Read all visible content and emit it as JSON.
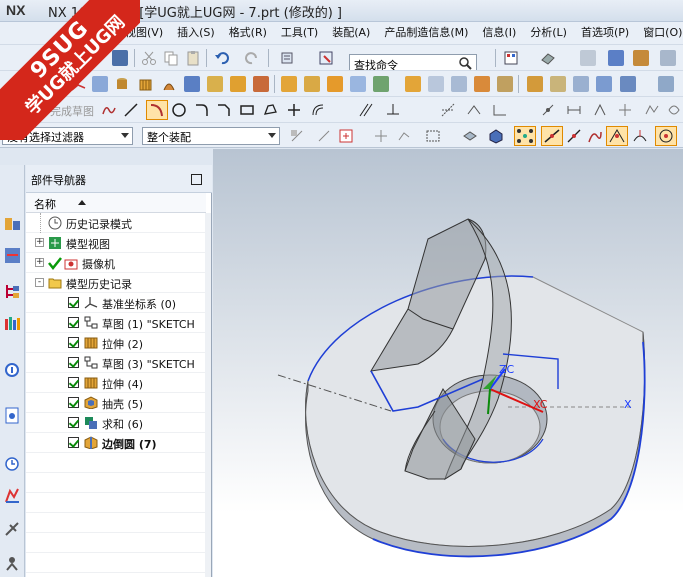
{
  "window": {
    "app_logo": "NX",
    "title": "NX 10 - 建模 - [学UG就上UG网 - 7.prt  (修改的) ]"
  },
  "menu": {
    "items": [
      "视图(V)",
      "插入(S)",
      "格式(R)",
      "工具(T)",
      "装配(A)",
      "产品制造信息(M)",
      "信息(I)",
      "分析(L)",
      "首选项(P)",
      "窗口(O)"
    ]
  },
  "toolbar": {
    "command_search_placeholder": "查找命令",
    "sketch_finish_label": "完成草图",
    "filter_select": "没有选择过滤器",
    "assembly_select": "整个装配"
  },
  "navigator": {
    "title": "部件导航器",
    "column_name": "名称",
    "items": [
      {
        "label": "历史记录模式",
        "icon": "clock-icon",
        "level": 1,
        "checked": false,
        "expander": ""
      },
      {
        "label": "模型视图",
        "icon": "model-views-icon",
        "level": 1,
        "checked": false,
        "expander": "+"
      },
      {
        "label": "摄像机",
        "icon": "camera-icon",
        "level": 1,
        "checked": true,
        "expander": "+"
      },
      {
        "label": "模型历史记录",
        "icon": "folder-icon",
        "level": 1,
        "checked": false,
        "expander": "-"
      },
      {
        "label": "基准坐标系 (0)",
        "icon": "datum-csys-icon",
        "level": 2,
        "checked": true
      },
      {
        "label": "草图 (1) \"SKETCH",
        "icon": "sketch-icon",
        "level": 2,
        "checked": true
      },
      {
        "label": "拉伸 (2)",
        "icon": "extrude-icon",
        "level": 2,
        "checked": true
      },
      {
        "label": "草图 (3) \"SKETCH",
        "icon": "sketch-icon",
        "level": 2,
        "checked": true
      },
      {
        "label": "拉伸 (4)",
        "icon": "extrude-icon",
        "level": 2,
        "checked": true
      },
      {
        "label": "抽壳 (5)",
        "icon": "shell-icon",
        "level": 2,
        "checked": true
      },
      {
        "label": "求和 (6)",
        "icon": "unite-icon",
        "level": 2,
        "checked": true
      },
      {
        "label": "边倒圆 (7)",
        "icon": "edge-blend-icon",
        "level": 2,
        "checked": true,
        "bold": true
      }
    ]
  },
  "viewport": {
    "axis_x": "X",
    "axis_xc": "XC",
    "axis_zc": "ZC",
    "edge_highlight_color": "#1f3fd6",
    "background_top": "#b8c4d2",
    "background_bottom": "#ffffff"
  },
  "watermark": {
    "line1": "9SUG",
    "line2": "学UG就上UG网"
  }
}
